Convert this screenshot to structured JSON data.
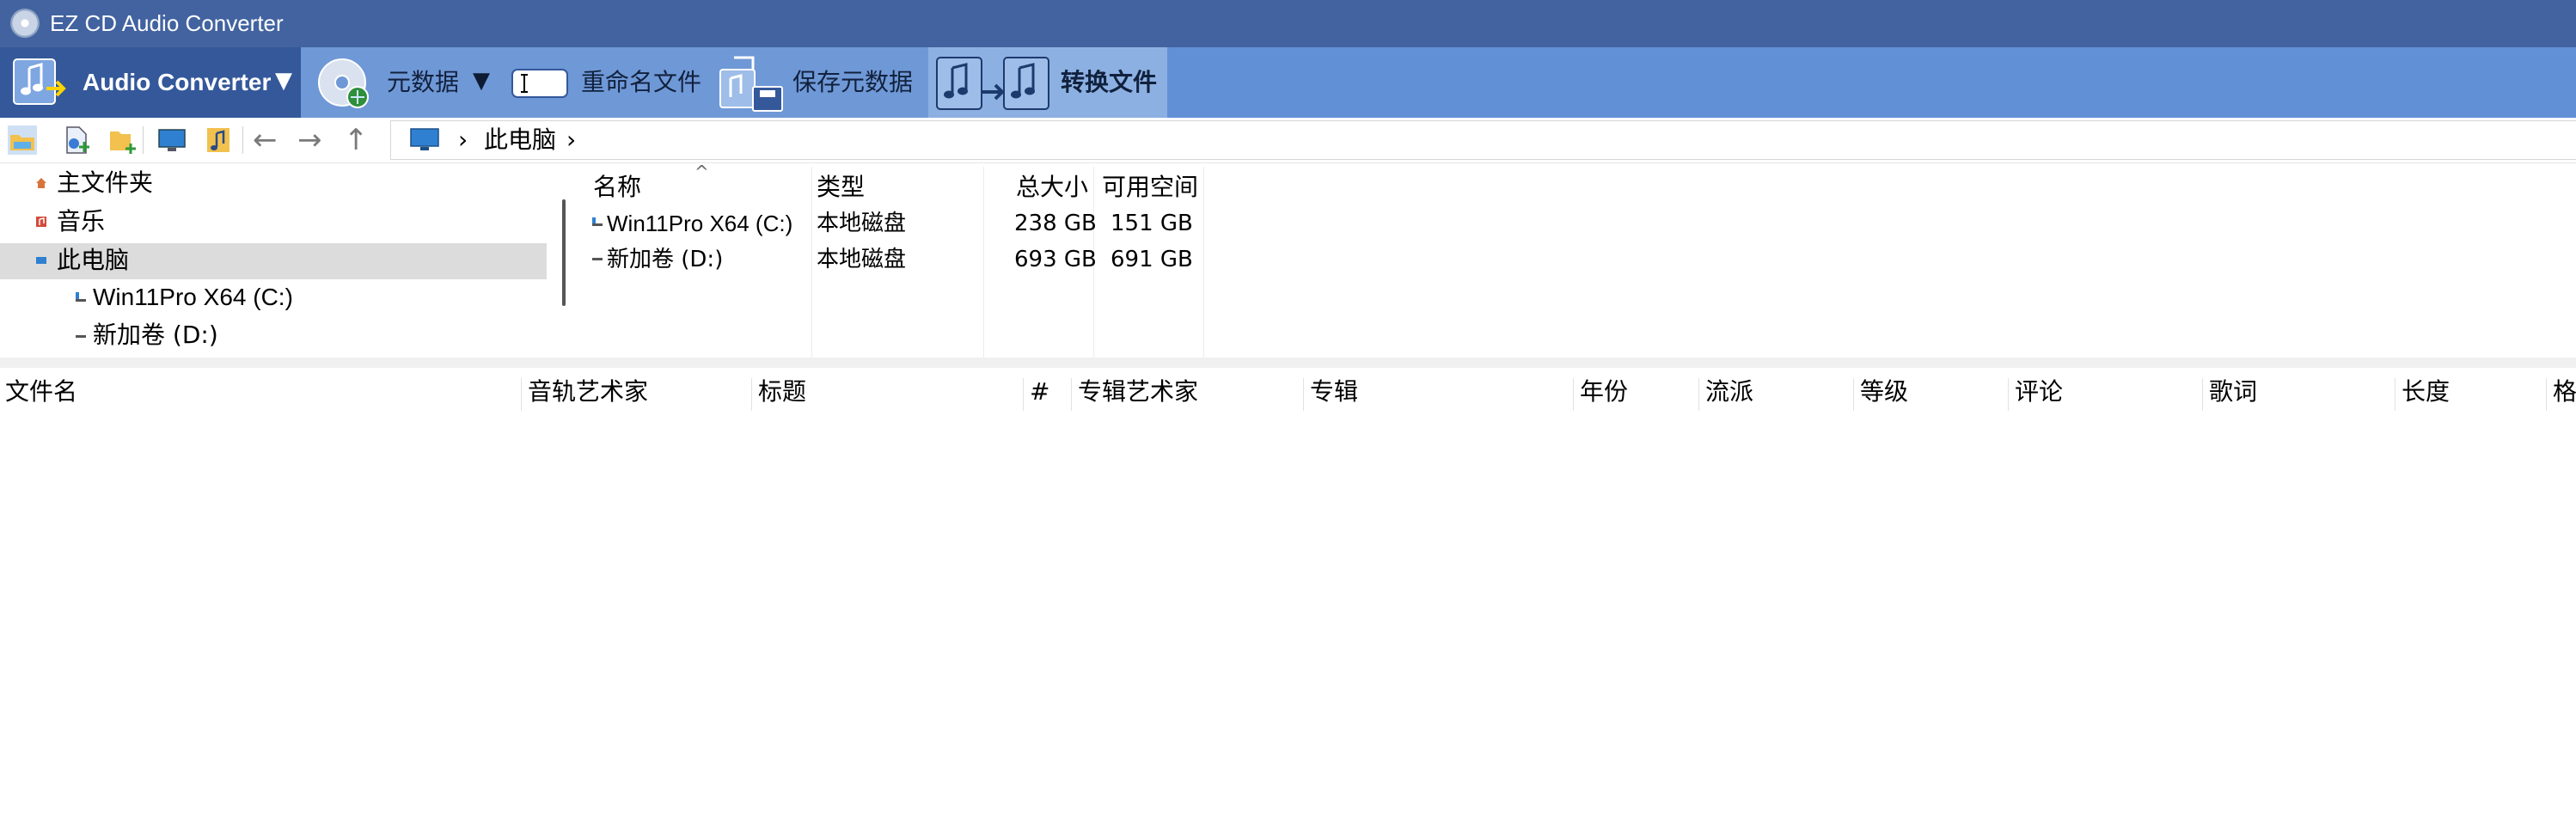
{
  "window": {
    "title": "EZ CD Audio Converter"
  },
  "ribbon": {
    "audio_converter": "Audio Converter",
    "metadata": "元数据",
    "rename_files": "重命名文件",
    "save_metadata": "保存元数据",
    "convert_files": "转换文件",
    "caret": "▼"
  },
  "nav": {
    "back": "←",
    "forward": "→",
    "up": "↑",
    "breadcrumb_sep": "›",
    "breadcrumb_item": "此电脑",
    "breadcrumb_trailing": "›"
  },
  "tree": {
    "items": [
      {
        "label": "主文件夹",
        "icon": "home-icon"
      },
      {
        "label": "音乐",
        "icon": "music-folder-icon"
      },
      {
        "label": "此电脑",
        "icon": "computer-icon",
        "selected": true
      },
      {
        "label": "Win11Pro X64 (C:)",
        "icon": "drive-icon"
      },
      {
        "label": "新加卷 (D:)",
        "icon": "drive-icon"
      }
    ]
  },
  "drives": {
    "sort_indicator": "^",
    "columns": [
      "名称",
      "类型",
      "总大小",
      "可用空间"
    ],
    "rows": [
      {
        "name": "Win11Pro X64 (C:)",
        "type": "本地磁盘",
        "total": "238 GB",
        "free": "151 GB"
      },
      {
        "name": "新加卷 (D:)",
        "type": "本地磁盘",
        "total": "693 GB",
        "free": "691 GB"
      }
    ]
  },
  "tracks": {
    "columns": [
      "文件名",
      "音轨艺术家",
      "标题",
      "#",
      "专辑艺术家",
      "专辑",
      "年份",
      "流派",
      "等级",
      "评论",
      "歌词",
      "长度",
      "格"
    ]
  },
  "colors": {
    "titlebar": "#4263a0",
    "ribbon": "#6290d6",
    "ribbon_dark": "#34589a",
    "ribbon_active": "#8cb0e2",
    "selection": "#dcdcdc"
  }
}
